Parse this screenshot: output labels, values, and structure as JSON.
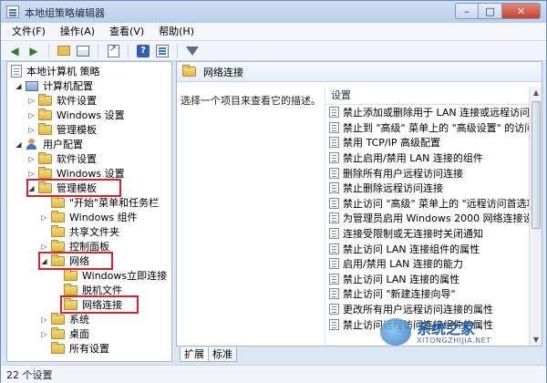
{
  "window": {
    "title": "本地组策略编辑器",
    "buttons": {
      "minimize": "–",
      "maximize": "□",
      "close": "✕"
    }
  },
  "menu": [
    "文件(F)",
    "操作(A)",
    "查看(V)",
    "帮助(H)"
  ],
  "toolbar": {
    "icons": [
      "back-icon",
      "forward-icon",
      "up-folder-icon",
      "show-hide-tree-icon",
      "export-list-icon",
      "help-icon",
      "properties-icon",
      "filter-icon"
    ]
  },
  "tree": {
    "root": "本地计算机 策略",
    "computer_config": "计算机配置",
    "cc_software": "软件设置",
    "cc_windows": "Windows 设置",
    "cc_admin": "管理模板",
    "user_config": "用户配置",
    "uc_software": "软件设置",
    "uc_windows": "Windows 设置",
    "uc_admin": "管理模板",
    "start_menu": "\"开始\"菜单和任务栏",
    "win_components": "Windows 组件",
    "shared_folders": "共享文件夹",
    "control_panel": "控制面板",
    "network": "网络",
    "win_instant": "Windows立即连接",
    "offline_files": "脱机文件",
    "net_connections": "网络连接",
    "system": "系统",
    "desktop": "桌面",
    "all_settings": "所有设置"
  },
  "right": {
    "header": "网络连接",
    "description": "选择一个项目来查看它的描述。",
    "column": "设置",
    "items": [
      "禁止添加或删除用于 LAN 连接或远程访问连接的",
      "禁止到 \"高级\" 菜单上的 \"高级设置\" 的访问",
      "禁用 TCP/IP 高级配置",
      "禁止启用/禁用 LAN 连接的组件",
      "删除所有用户远程访问连接",
      "禁止删除远程访问连接",
      "禁止访问 \"高级\" 菜单上的 \"远程访问首选项\" 菜",
      "为管理员启用 Windows 2000 网络连接设置",
      "连接受限制或无连接时关闭通知",
      "禁止访问 LAN 连接组件的属性",
      "启用/禁用 LAN 连接的能力",
      "禁止访问 LAN 连接的属性",
      "禁止访问 \"新建连接向导\"",
      "更改所有用户远程访问连接的属性",
      "禁止访问远程访问连接组件的属性"
    ]
  },
  "tabs": [
    "扩展",
    "标准"
  ],
  "status": "22 个设置",
  "watermark": {
    "text": "系统之家",
    "sub": "XITONGZHIJIA.NET"
  }
}
